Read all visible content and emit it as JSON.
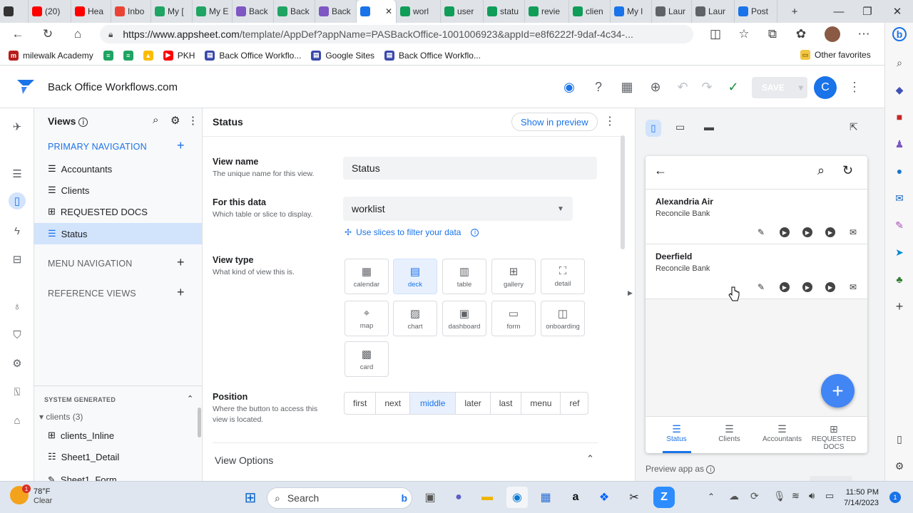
{
  "browser": {
    "tabs": [
      {
        "label": "",
        "icon": "tab-actions-icon",
        "color": "#333333"
      },
      {
        "label": "(20)",
        "icon": "youtube-icon",
        "color": "#ff0000"
      },
      {
        "label": "Hea",
        "icon": "youtube-icon",
        "color": "#ff0000"
      },
      {
        "label": "Inbo",
        "icon": "gmail-icon",
        "color": "#ea4335"
      },
      {
        "label": "My [",
        "icon": "drive-icon",
        "color": "#1fa463"
      },
      {
        "label": "My E",
        "icon": "drive-icon",
        "color": "#1fa463"
      },
      {
        "label": "Back",
        "icon": "sites-icon",
        "color": "#7e57c2"
      },
      {
        "label": "Back",
        "icon": "drive-icon",
        "color": "#1fa463"
      },
      {
        "label": "Back",
        "icon": "sites-icon",
        "color": "#7e57c2"
      },
      {
        "label": "",
        "icon": "appsheet-icon",
        "color": "#1a73e8",
        "active": true
      },
      {
        "label": "worl",
        "icon": "sheets-icon",
        "color": "#0f9d58"
      },
      {
        "label": "user",
        "icon": "sheets-icon",
        "color": "#0f9d58"
      },
      {
        "label": "statu",
        "icon": "sheets-icon",
        "color": "#0f9d58"
      },
      {
        "label": "revie",
        "icon": "sheets-icon",
        "color": "#0f9d58"
      },
      {
        "label": "clien",
        "icon": "sheets-icon",
        "color": "#0f9d58"
      },
      {
        "label": "My l",
        "icon": "zoho-icon",
        "color": "#1a73e8"
      },
      {
        "label": "Laur",
        "icon": "doc-icon",
        "color": "#5f6368"
      },
      {
        "label": "Laur",
        "icon": "doc-icon",
        "color": "#5f6368"
      },
      {
        "label": "Post",
        "icon": "zoho-icon",
        "color": "#1a73e8"
      }
    ],
    "url_prefix": "https://www.appsheet.com",
    "url_rest": "/template/AppDef?appName=PASBackOffice-1001006923&appId=e8f6222f-9daf-4c34-...",
    "bookmarks": [
      "milewalk Academy",
      "",
      "",
      "",
      "PKH",
      "Back Office Workflo...",
      "Google Sites",
      "Back Office Workflo..."
    ],
    "other_favorites": "Other favorites"
  },
  "app": {
    "title": "Back Office Workflows.com",
    "save_label": "SAVE",
    "avatar_letter": "C"
  },
  "views_panel": {
    "title": "Views",
    "primary_nav": "PRIMARY NAVIGATION",
    "items": [
      "Accountants",
      "Clients",
      "REQUESTED DOCS",
      "Status"
    ],
    "menu_nav": "MENU NAVIGATION",
    "reference_views": "REFERENCE VIEWS",
    "system_generated": "SYSTEM GENERATED",
    "clients_group": "clients (3)",
    "system_items": [
      "clients_Inline",
      "Sheet1_Detail",
      "Sheet1_Form"
    ]
  },
  "editor": {
    "title": "Status",
    "show_preview": "Show in preview",
    "view_name_label": "View name",
    "view_name_desc": "The unique name for this view.",
    "view_name_value": "Status",
    "for_data_label": "For this data",
    "for_data_desc": "Which table or slice to display.",
    "for_data_value": "worklist",
    "slices_link": "Use slices to filter your data",
    "view_type_label": "View type",
    "view_type_desc": "What kind of view this is.",
    "view_types": [
      "calendar",
      "deck",
      "table",
      "gallery",
      "detail",
      "map",
      "chart",
      "dashboard",
      "form",
      "onboarding",
      "card"
    ],
    "selected_view_type": "deck",
    "position_label": "Position",
    "position_desc": "Where the button to access this view is located.",
    "positions": [
      "first",
      "next",
      "middle",
      "later",
      "last",
      "menu",
      "ref"
    ],
    "selected_position": "middle",
    "view_options": "View Options"
  },
  "preview": {
    "cards": [
      {
        "title": "Alexandria Air",
        "subtitle": "Reconcile Bank"
      },
      {
        "title": "Deerfield",
        "subtitle": "Reconcile Bank"
      }
    ],
    "nav": [
      "Status",
      "Clients",
      "Accountants",
      "REQUESTED DOCS"
    ],
    "preview_as": "Preview app as"
  },
  "taskbar": {
    "weather_temp": "78°F",
    "weather_desc": "Clear",
    "weather_badge": "1",
    "search_placeholder": "Search",
    "time": "11:50 PM",
    "date": "7/14/2023",
    "notif_count": "1"
  },
  "colors": {
    "accent": "#1a73e8",
    "selected_bg": "#d2e3fc",
    "fab": "#4285f4"
  }
}
